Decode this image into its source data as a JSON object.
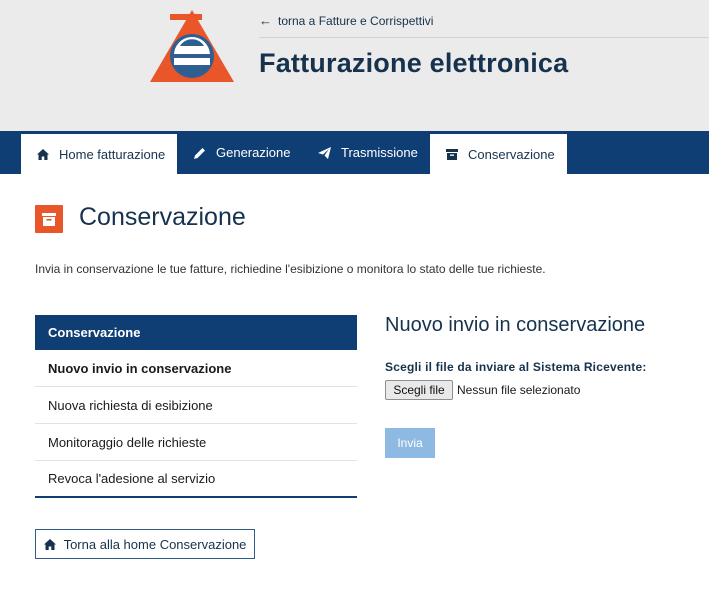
{
  "header": {
    "back_link": "torna a Fatture e Corrispettivi",
    "title": "Fatturazione elettronica",
    "logo_icon": "agenzia-entrate-logo",
    "back_icon": "arrow-left-icon"
  },
  "navbar": {
    "tabs": [
      {
        "label": "Home fatturazione",
        "icon": "home-icon",
        "active": false
      },
      {
        "label": "Generazione",
        "icon": "pencil-icon",
        "active": false
      },
      {
        "label": "Trasmissione",
        "icon": "paper-plane-icon",
        "active": false
      },
      {
        "label": "Conservazione",
        "icon": "archive-icon",
        "active": true
      }
    ]
  },
  "page": {
    "title": "Conservazione",
    "icon": "archive-box-icon",
    "intro": "Invia in conservazione le tue fatture, richiedine l'esibizione o monitora lo stato delle tue richieste."
  },
  "side_menu": {
    "heading": "Conservazione",
    "items": [
      {
        "label": "Nuovo invio in conservazione",
        "active": true
      },
      {
        "label": "Nuova richiesta di esibizione",
        "active": false
      },
      {
        "label": "Monitoraggio delle richieste",
        "active": false
      },
      {
        "label": "Revoca l'adesione al servizio",
        "active": false
      }
    ],
    "home_button": "Torna alla home Conservazione"
  },
  "form": {
    "title": "Nuovo invio in conservazione",
    "file_label": "Scegli il file da inviare al Sistema Ricevente:",
    "file_button": "Scegli file",
    "file_status": "Nessun file selezionato",
    "submit": "Invia"
  },
  "colors": {
    "navy": "#0f3e74",
    "title_blue": "#17324d",
    "orange": "#e8562a",
    "header_bg": "#ebebeb",
    "submit_disabled": "#8db9e2"
  }
}
